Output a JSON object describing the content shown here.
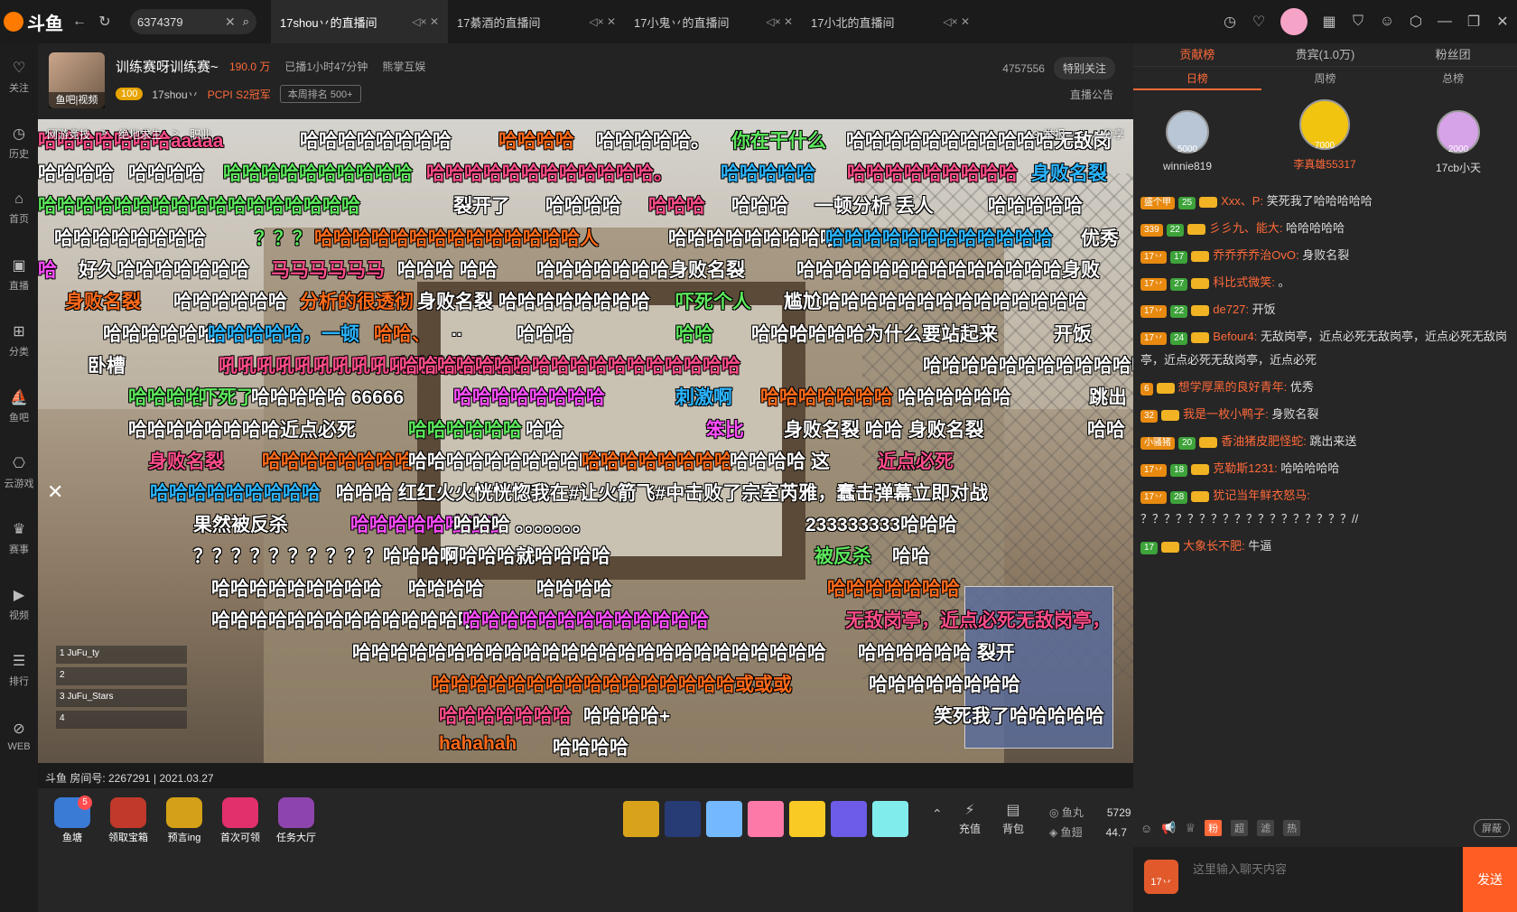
{
  "app": {
    "logo": "斗鱼"
  },
  "search": {
    "value": "6374379"
  },
  "tabs": [
    {
      "label": "17shou丷的直播间"
    },
    {
      "label": "17綦酒的直播间"
    },
    {
      "label": "17小鬼丷的直播间"
    },
    {
      "label": "17小北的直播间"
    }
  ],
  "leftnav": [
    {
      "label": "关注",
      "icon": "heart-icon"
    },
    {
      "label": "历史",
      "icon": "clock-icon"
    },
    {
      "label": "首页",
      "icon": "home-icon"
    },
    {
      "label": "直播",
      "icon": "tv-icon"
    },
    {
      "label": "分类",
      "icon": "grid-icon"
    },
    {
      "label": "鱼吧",
      "icon": "fish-icon"
    },
    {
      "label": "云游戏",
      "icon": "gamepad-icon"
    },
    {
      "label": "赛事",
      "icon": "trophy-icon"
    },
    {
      "label": "视频",
      "icon": "video-icon"
    },
    {
      "label": "排行",
      "icon": "rank-icon"
    },
    {
      "label": "WEB",
      "icon": "compass-icon"
    }
  ],
  "streamer": {
    "avatar_badge": "鱼吧|视频",
    "title": "训练赛呀训练赛~",
    "hot": "190.0 万",
    "duration": "已播1小时47分钟",
    "org": "熊掌互娱",
    "level": "100",
    "name": "17shou丷",
    "pcpi": "PCPI S2冠军",
    "rank": "本周排名 500+",
    "fans": "4757556",
    "follow": "特别关注",
    "notice": "直播公告"
  },
  "video": {
    "breadcrumb": [
      "网游竞技",
      "绝地求生",
      "职业"
    ],
    "report": "举报",
    "share": "分享",
    "room_info": "斗鱼 房间号: 2267291 | 2021.03.27"
  },
  "danmaku": [
    {
      "text": "哈哈哈哈哈哈哈aaaaa",
      "color": "#ff4d8a"
    },
    {
      "text": "哈哈哈哈哈哈哈哈",
      "color": "#ffffff"
    },
    {
      "text": "哈哈哈哈",
      "color": "#ff6a1a"
    },
    {
      "text": "哈哈哈哈哈。",
      "color": "#ffffff"
    },
    {
      "text": "你在干什么",
      "color": "#5ce85c"
    },
    {
      "text": "哈哈哈哈哈哈哈哈哈哈哈无敌岗",
      "color": "#ffffff"
    },
    {
      "text": "哈哈哈哈",
      "color": "#ffffff"
    },
    {
      "text": "哈哈哈哈",
      "color": "#ffffff"
    },
    {
      "text": "哈哈哈哈哈哈哈哈哈哈",
      "color": "#5ce85c"
    },
    {
      "text": "哈哈哈哈哈哈哈哈哈哈哈哈。",
      "color": "#ff4d8a"
    },
    {
      "text": "哈哈哈哈哈",
      "color": "#2bb5ff"
    },
    {
      "text": "哈哈哈哈哈哈哈哈哈",
      "color": "#ff4d8a"
    },
    {
      "text": "身败名裂",
      "color": "#2bb5ff"
    },
    {
      "text": "哈哈哈哈哈哈哈哈哈哈哈哈哈哈哈哈哈",
      "color": "#5ce85c"
    },
    {
      "text": "裂开了",
      "color": "#ffffff"
    },
    {
      "text": "哈哈哈哈",
      "color": "#ffffff"
    },
    {
      "text": "哈哈哈",
      "color": "#ff4d8a"
    },
    {
      "text": "哈哈哈",
      "color": "#ffffff"
    },
    {
      "text": "一顿分析 丢人",
      "color": "#ffffff"
    },
    {
      "text": "哈哈哈哈哈",
      "color": "#ffffff"
    },
    {
      "text": "哈哈哈哈哈哈哈哈",
      "color": "#ffffff"
    },
    {
      "text": "？？？",
      "color": "#5ce85c"
    },
    {
      "text": "哈哈哈哈哈哈哈哈哈哈哈哈哈哈人",
      "color": "#ff6a1a"
    },
    {
      "text": "哈哈哈哈哈哈哈哈哈",
      "color": "#ffffff"
    },
    {
      "text": "哈哈哈哈哈哈哈哈哈哈哈哈",
      "color": "#2bb5ff"
    },
    {
      "text": "优秀",
      "color": "#ffffff"
    },
    {
      "text": "哈",
      "color": "#ff4dff"
    },
    {
      "text": "好久哈哈哈哈哈哈哈",
      "color": "#ffffff"
    },
    {
      "text": "马马马马马马",
      "color": "#ff4d8a"
    },
    {
      "text": "哈哈哈 哈哈",
      "color": "#ffffff"
    },
    {
      "text": "哈哈哈哈哈哈哈身败名裂",
      "color": "#ffffff"
    },
    {
      "text": "哈哈哈哈哈哈哈哈哈哈哈哈哈哈身败",
      "color": "#ffffff"
    },
    {
      "text": "身败名裂",
      "color": "#ff6a1a"
    },
    {
      "text": "哈哈哈哈哈哈",
      "color": "#ffffff"
    },
    {
      "text": "分析的很透彻",
      "color": "#ff6a1a"
    },
    {
      "text": "身败名裂 哈哈哈哈哈哈哈哈",
      "color": "#ffffff"
    },
    {
      "text": "吓死个人",
      "color": "#5ce85c"
    },
    {
      "text": "尴尬哈哈哈哈哈哈哈哈哈哈哈哈哈哈",
      "color": "#ffffff"
    },
    {
      "text": "哈哈哈哈哈哈",
      "color": "#ffffff"
    },
    {
      "text": "哈哈哈哈哈，一顿",
      "color": "#2bb5ff"
    },
    {
      "text": "哈哈、",
      "color": "#ff6a1a"
    },
    {
      "text": "..",
      "color": "#ffffff"
    },
    {
      "text": "哈哈哈",
      "color": "#ffffff"
    },
    {
      "text": "哈哈",
      "color": "#5ce85c"
    },
    {
      "text": "哈哈哈哈哈哈为什么要站起来",
      "color": "#ffffff"
    },
    {
      "text": "开饭",
      "color": "#ffffff"
    },
    {
      "text": "卧槽",
      "color": "#ffffff"
    },
    {
      "text": "吼吼吼吼吼吼吼吼吼吼吼吼吼吼吼吼",
      "color": "#ff4d8a"
    },
    {
      "text": "哈哈哈哈哈哈哈哈哈哈哈哈哈哈哈哈哈哈",
      "color": "#ff4d8a"
    },
    {
      "text": "哈哈哈哈哈哈哈哈哈哈哈哈",
      "color": "#ffffff"
    },
    {
      "text": "哈哈哈哈",
      "color": "#5ce85c"
    },
    {
      "text": "吓死了",
      "color": "#5ce85c"
    },
    {
      "text": "哈哈哈哈哈 66666",
      "color": "#ffffff"
    },
    {
      "text": "哈哈哈哈哈哈哈哈",
      "color": "#ff4dff"
    },
    {
      "text": "刺激啊",
      "color": "#2bb5ff"
    },
    {
      "text": "哈哈哈哈哈哈哈",
      "color": "#ff6a1a"
    },
    {
      "text": "哈哈哈哈哈哈",
      "color": "#ffffff"
    },
    {
      "text": "跳出",
      "color": "#ffffff"
    },
    {
      "text": "哈哈哈哈哈哈哈哈近点必死",
      "color": "#ffffff"
    },
    {
      "text": "哈哈哈哈哈哈",
      "color": "#5ce85c"
    },
    {
      "text": "哈哈",
      "color": "#ffffff"
    },
    {
      "text": "笨比",
      "color": "#ff4dff"
    },
    {
      "text": "身败名裂 哈哈 身败名裂",
      "color": "#ffffff"
    },
    {
      "text": "哈哈",
      "color": "#ffffff"
    },
    {
      "text": "身败名裂",
      "color": "#ff4d8a"
    },
    {
      "text": "哈哈哈哈哈哈哈哈",
      "color": "#ff6a1a"
    },
    {
      "text": "哈哈哈哈哈哈哈哈哈哈哈",
      "color": "#ffffff"
    },
    {
      "text": "哈哈哈哈哈哈哈哈",
      "color": "#ff6a1a"
    },
    {
      "text": "哈哈哈哈 这",
      "color": "#ffffff"
    },
    {
      "text": "近点必死",
      "color": "#ff4d8a"
    },
    {
      "text": "哈哈哈哈哈哈哈哈哈",
      "color": "#2bb5ff"
    },
    {
      "text": "哈哈哈 红红火火恍恍惚我在#让火箭飞#中击败了宗室芮雅，蠢击弹幕立即对战",
      "color": "#ffffff"
    },
    {
      "text": "果然被反杀",
      "color": "#ffffff"
    },
    {
      "text": "哈哈哈哈哈哈哈哈",
      "color": "#ff4dff"
    },
    {
      "text": "哈哈哈 。。。。。。。",
      "color": "#ffffff"
    },
    {
      "text": "233333333哈哈哈",
      "color": "#ffffff"
    },
    {
      "text": "？？？？？？？？？？哈哈哈啊哈哈哈就哈哈哈哈",
      "color": "#ffffff"
    },
    {
      "text": "被反杀",
      "color": "#5ce85c"
    },
    {
      "text": "哈哈",
      "color": "#ffffff"
    },
    {
      "text": "哈哈哈哈哈哈哈哈哈",
      "color": "#ffffff"
    },
    {
      "text": "哈哈哈哈",
      "color": "#ffffff"
    },
    {
      "text": "哈哈哈哈",
      "color": "#ffffff"
    },
    {
      "text": "哈哈哈哈哈哈哈",
      "color": "#ff6a1a"
    },
    {
      "text": "哈哈哈哈哈哈哈哈哈哈哈哈哈哈",
      "color": "#ffffff"
    },
    {
      "text": "哈哈哈哈哈哈哈哈哈哈哈哈哈",
      "color": "#ff4dff"
    },
    {
      "text": "无敌岗亭，近点必死无敌岗亭，",
      "color": "#ff4d8a"
    },
    {
      "text": "哈哈哈哈哈哈哈哈哈哈哈哈哈哈哈哈哈哈哈哈哈哈哈哈哈",
      "color": "#ffffff"
    },
    {
      "text": "哈哈哈哈哈哈 裂开",
      "color": "#ffffff"
    },
    {
      "text": "哈哈哈哈哈哈哈哈哈哈哈哈哈哈哈哈或或或",
      "color": "#ff6a1a"
    },
    {
      "text": "哈哈哈哈哈哈哈哈",
      "color": "#ffffff"
    },
    {
      "text": "哈哈哈哈哈哈哈",
      "color": "#ff4d8a"
    },
    {
      "text": "哈哈哈哈+",
      "color": "#ffffff"
    },
    {
      "text": "笑死我了哈哈哈哈哈",
      "color": "#ffffff"
    },
    {
      "text": "hahahah",
      "color": "#ff6a1a"
    },
    {
      "text": "哈哈哈哈",
      "color": "#ffffff"
    }
  ],
  "team": [
    {
      "num": "1",
      "name": "JuFu_ty"
    },
    {
      "num": "2",
      "name": ""
    },
    {
      "num": "3",
      "name": "JuFu_Stars"
    },
    {
      "num": "4",
      "name": ""
    }
  ],
  "toolbar": {
    "left": [
      {
        "label": "鱼塘",
        "badge": "5"
      },
      {
        "label": "领取宝箱"
      },
      {
        "label": "预言ing"
      },
      {
        "label": "首次可领"
      },
      {
        "label": "任务大厅"
      }
    ],
    "actions": [
      {
        "label": "充值"
      },
      {
        "label": "背包"
      }
    ],
    "wallet": {
      "yuwan_label": "鱼丸",
      "yuwan": "5729",
      "yuchi_label": "鱼翅",
      "yuchi": "44.7"
    }
  },
  "right": {
    "tabs": [
      "贡献榜",
      "贵宾(1.0万)",
      "粉丝团"
    ],
    "subtabs": [
      "日榜",
      "周榜",
      "总榜"
    ],
    "podium": [
      {
        "name": "winnie819",
        "score": "5000"
      },
      {
        "name": "李真雄55317",
        "score": "7000"
      },
      {
        "name": "17cb小天",
        "score": "2000"
      }
    ],
    "messages": [
      {
        "fan": "盛个甲",
        "lv": "25",
        "user": "Xxx、P:",
        "text": "笑死我了哈哈哈哈哈"
      },
      {
        "fan": "339",
        "lv": "22",
        "user": "彡彡九、能大:",
        "text": "哈哈哈哈哈"
      },
      {
        "fan": "17丷",
        "lv": "17",
        "user": "乔乔乔乔治OvO:",
        "text": "身败名裂"
      },
      {
        "fan": "17丷",
        "lv": "27",
        "user": "科比式微笑:",
        "text": "。"
      },
      {
        "fan": "17丷",
        "lv": "22",
        "user": "de727:",
        "text": "开饭"
      },
      {
        "fan": "17丷",
        "lv": "24",
        "user": "Befour4:",
        "text": "无敌岗亭，近点必死无敌岗亭，近点必死无敌岗亭，近点必死无敌岗亭，近点必死"
      },
      {
        "fan": "6",
        "lv": "",
        "user": "想学厚黑的良好青年:",
        "text": "优秀"
      },
      {
        "fan": "32",
        "lv": "",
        "user": "我是一枚小鸭子:",
        "text": "身败名裂"
      },
      {
        "fan": "小骚猪",
        "lv": "20",
        "user": "香油猪皮肥怪蛇:",
        "text": "跳出来送"
      },
      {
        "fan": "17丷",
        "lv": "18",
        "user": "克勒斯1231:",
        "text": "哈哈哈哈哈"
      },
      {
        "fan": "17丷",
        "lv": "28",
        "user": "犹记当年鲜衣怒马:",
        "text": "？？？？？？？？？？？？？？？？？？//"
      },
      {
        "fan": "",
        "lv": "17",
        "user": "大象长不肥:",
        "text": "牛逼"
      }
    ],
    "tools": [
      "粉",
      "超",
      "滤",
      "热"
    ],
    "shield": "屏蔽",
    "input_placeholder": "这里输入聊天内容",
    "fan_badge": "17丷",
    "send": "发送"
  }
}
